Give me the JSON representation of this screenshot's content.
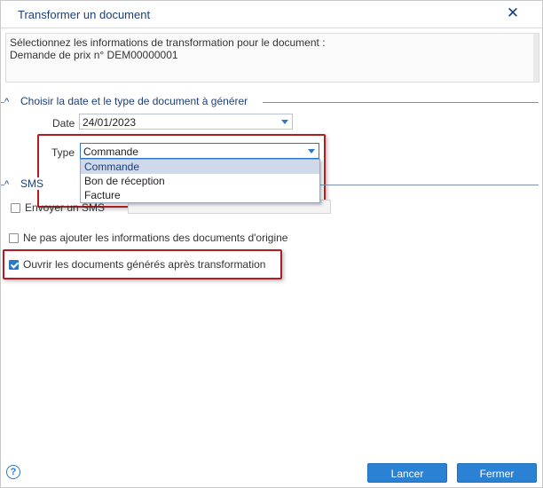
{
  "dialog": {
    "title": "Transformer un document",
    "close_glyph": "✕"
  },
  "info": {
    "line1": "Sélectionnez les informations de transformation pour le document :",
    "line2": "Demande de prix n° DEM00000001"
  },
  "section_date_type": {
    "toggle_glyph": "^",
    "caption": "Choisir la date et le type de document à générer",
    "date_label": "Date",
    "date_value": "24/01/2023",
    "type_label": "Type",
    "type_value": "Commande",
    "type_options": [
      "Commande",
      "Bon de réception",
      "Facture"
    ],
    "selected_option_index": 0
  },
  "section_sms": {
    "toggle_glyph": "^",
    "caption": "SMS",
    "send_sms_label": "Envoyer un SMS",
    "send_sms_checked": false
  },
  "options": {
    "no_origin_info_label": "Ne pas ajouter les informations des documents d'origine",
    "no_origin_info_checked": false,
    "open_generated_label": "Ouvrir les documents générés après transformation",
    "open_generated_checked": true
  },
  "footer": {
    "help_glyph": "?",
    "launch_label": "Lancer",
    "close_label": "Fermer"
  },
  "colors": {
    "accent": "#2b82d4",
    "title": "#1b3f7a",
    "highlight": "#b01e24"
  },
  "icons": {
    "close": "close-icon",
    "collapse": "chevron-up-icon",
    "dropdown": "chevron-down-icon",
    "help": "help-icon",
    "check": "checkmark-icon"
  }
}
